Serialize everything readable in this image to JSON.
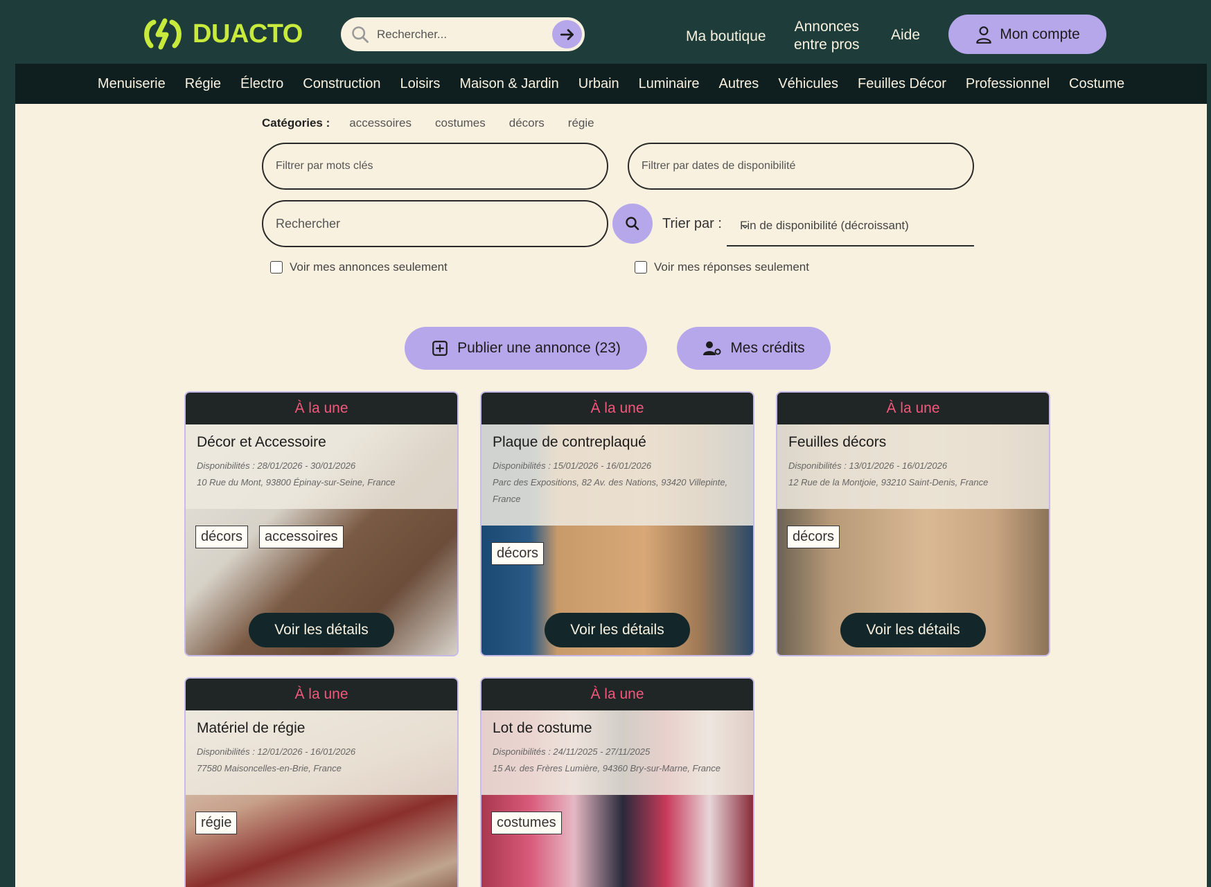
{
  "brand": {
    "name": "DUACTO",
    "accent": "#c8ea3c",
    "lavender": "#b6a7ea",
    "header_bg": "#1e3d3a",
    "page_bg": "#f8f1df"
  },
  "header": {
    "search_placeholder": "Rechercher...",
    "nav": {
      "shop": "Ma boutique",
      "pros_line1": "Annonces",
      "pros_line2": "entre pros",
      "help": "Aide"
    },
    "account_label": "Mon compte"
  },
  "categories_bar": [
    "Menuiserie",
    "Régie",
    "Électro",
    "Construction",
    "Loisirs",
    "Maison & Jardin",
    "Urbain",
    "Luminaire",
    "Autres",
    "Véhicules",
    "Feuilles Décor",
    "Professionnel",
    "Costume"
  ],
  "filters": {
    "categories_label": "Catégories :",
    "category_chips": [
      "accessoires",
      "costumes",
      "décors",
      "régie"
    ],
    "keywords_placeholder": "Filtrer par mots clés",
    "dates_placeholder": "Filtrer par dates de disponibilité",
    "search_placeholder": "Rechercher",
    "sort_label": "Trier par :",
    "sort_value": "Fin de disponibilité (décroissant)",
    "only_mine": "Voir mes annonces seulement",
    "only_responses": "Voir mes réponses seulement"
  },
  "actions": {
    "publish": "Publier une annonce (23)",
    "credits": "Mes crédits"
  },
  "listings": [
    {
      "badge": "À la une",
      "title": "Décor et Accessoire",
      "dates": "Disponibilités : 28/01/2026 - 30/01/2026",
      "address": "10 Rue du Mont, 93800 Épinay-sur-Seine, France",
      "address2": "",
      "tags": [
        "décors",
        "accessoires"
      ],
      "button": "Voir les détails"
    },
    {
      "badge": "À la une",
      "title": "Plaque de contreplaqué",
      "dates": "Disponibilités : 15/01/2026 - 16/01/2026",
      "address": "Parc des Expositions, 82 Av. des Nations, 93420 Villepinte,",
      "address2": "France",
      "tags": [
        "décors"
      ],
      "button": "Voir les détails"
    },
    {
      "badge": "À la une",
      "title": "Feuilles décors",
      "dates": "Disponibilités : 13/01/2026 - 16/01/2026",
      "address": "12 Rue de la Montjoie, 93210 Saint-Denis, France",
      "address2": "",
      "tags": [
        "décors"
      ],
      "button": "Voir les détails"
    },
    {
      "badge": "À la une",
      "title": "Matériel de régie",
      "dates": "Disponibilités : 12/01/2026 - 16/01/2026",
      "address": "77580 Maisoncelles-en-Brie, France",
      "address2": "",
      "tags": [
        "régie"
      ],
      "button": ""
    },
    {
      "badge": "À la une",
      "title": "Lot de costume",
      "dates": "Disponibilités : 24/11/2025 - 27/11/2025",
      "address": "15 Av. des Frères Lumière, 94360 Bry-sur-Marne, France",
      "address2": "",
      "tags": [
        "costumes"
      ],
      "button": ""
    }
  ]
}
